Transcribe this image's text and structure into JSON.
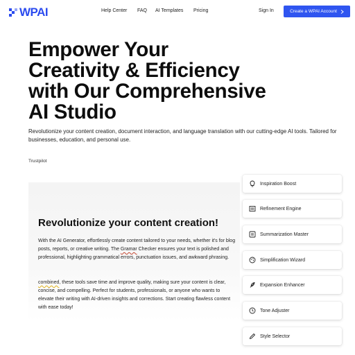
{
  "header": {
    "logo_text": "WPAI",
    "nav": [
      "Help Center",
      "FAQ",
      "AI Templates",
      "Pricing"
    ],
    "sign_in": "Sign In",
    "cta_label": "Create a WPAI Account",
    "cta_icon": "chevron-right-icon",
    "brand_color": "#2f55f0"
  },
  "hero": {
    "title_lines": [
      "Empower Your",
      "Creativity & Efficiency",
      "with Our Comprehensive",
      "AI Studio"
    ],
    "subtitle": "Revolutionize your content creation, document interaction, and language translation with our cutting-edge AI tools. Tailored for businesses, education, and personal use.",
    "trust": "Trustpilot"
  },
  "content": {
    "title": "Revolutionize your content creation!",
    "p1_a": "With the AI Generator, effortlessly create content tailored to your needs, whether it's for blog posts, reports, or creative writing. The ",
    "p1_err": "Gramar",
    "p1_b": " Checker ensures your text is polished and professional, highlighting grammatical errors, punctuation issues, and awkward phrasing.",
    "p2_err": "combined",
    "p2_b": ", these tools save time and improve quality, making sure your content is clear, concise, and compelling. Perfect for students, professionals, or anyone who wants to elevate their writing with AI-driven insights and corrections. Start creating flawless content with ease today!"
  },
  "features": [
    {
      "label": "Inspiration Boost",
      "icon": "lightbulb-icon"
    },
    {
      "label": "Refinement Engine",
      "icon": "sliders-icon"
    },
    {
      "label": "Summarization Master",
      "icon": "list-icon"
    },
    {
      "label": "Simplification Wizard",
      "icon": "palette-icon"
    },
    {
      "label": "Expansion Enhancer",
      "icon": "feather-icon"
    },
    {
      "label": "Tone Adjuster",
      "icon": "clock-icon"
    },
    {
      "label": "Style Selector",
      "icon": "pen-icon"
    }
  ]
}
